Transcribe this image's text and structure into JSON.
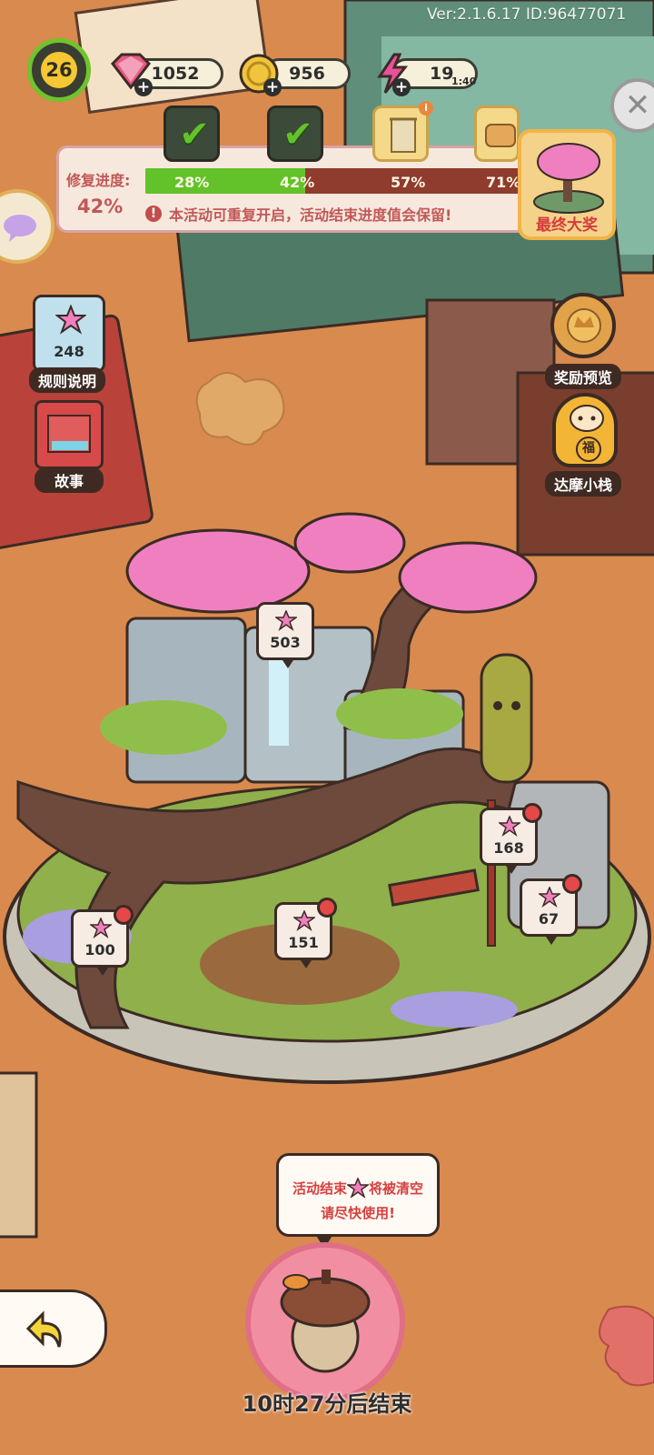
{
  "version_text": "Ver:2.1.6.17 ID:96477071",
  "level": "26",
  "resources": {
    "gems": "1052",
    "coins": "956",
    "energy": "19",
    "energy_timer": "1:40"
  },
  "repair_progress": {
    "label": "修复进度:",
    "value": "42%",
    "fill_percent": 42,
    "milestones": [
      "28%",
      "42%",
      "57%",
      "71%"
    ],
    "notice": "本活动可重复开启，活动结束进度值会保留!",
    "final_prize_label": "最终大奖"
  },
  "side_left": {
    "rules_count": "248",
    "rules_label": "规则说明",
    "story_label": "故事"
  },
  "side_right": {
    "reward_preview_label": "奖励预览",
    "shop_label": "达摩小栈",
    "shop_badge": "福"
  },
  "plots": [
    {
      "name": "tree-top",
      "value": "503",
      "badge": false
    },
    {
      "name": "lamp",
      "value": "168",
      "badge": true
    },
    {
      "name": "rock",
      "value": "67",
      "badge": true
    },
    {
      "name": "left-bush",
      "value": "100",
      "badge": true
    },
    {
      "name": "cave",
      "value": "151",
      "badge": true
    }
  ],
  "bubble": {
    "line1_a": "活动结束",
    "line1_b": "将被清空",
    "line2": "请尽快使用!"
  },
  "timer": "10时27分后结束",
  "colors": {
    "accent_red": "#c15858",
    "progress_green": "#63c22a",
    "flower_pink": "#f07fc0"
  }
}
